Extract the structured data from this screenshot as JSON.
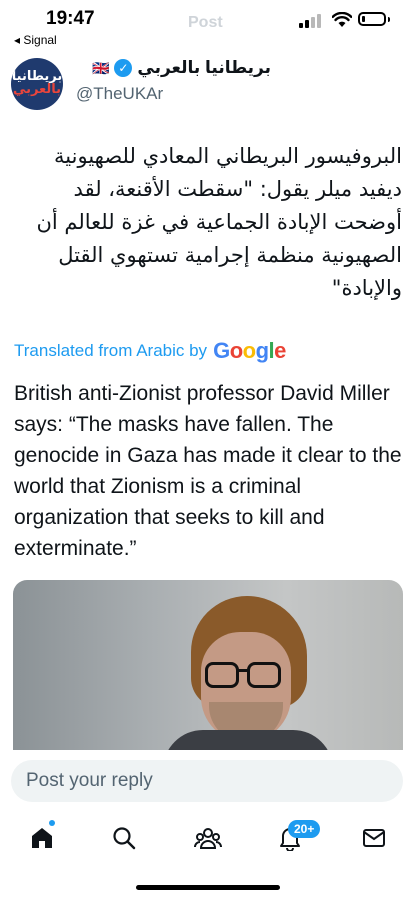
{
  "status_bar": {
    "time": "19:47",
    "back_app": "◂ Signal",
    "faded_title": "Post",
    "signal_bars": 2,
    "battery_level": 0.15
  },
  "post": {
    "author_name": "بريطانيا بالعربي",
    "author_flag": "🇬🇧",
    "handle": "@TheUKAr",
    "avatar_text_line1": "بريطانيا",
    "avatar_text_line2": "بالعربي",
    "arabic_text": "البروفيسور البريطاني المعادي للصهيونية ديفيد ميلر يقول: \"سقطت الأقنعة، لقد أوضحت الإبادة الجماعية في غزة للعالم أن الصهيونية منظمة إجرامية تستهوي القتل والإبادة\"",
    "translated_label": "Translated from Arabic by",
    "google_logo": {
      "G": "G",
      "o1": "o",
      "o2": "o",
      "g": "g",
      "l": "l",
      "e": "e"
    },
    "english_text": "British anti-Zionist professor David Miller says: “The masks have fallen. The genocide in Gaza has made it clear to the world that Zionism is a criminal organization that seeks to kill and exterminate.”"
  },
  "reply": {
    "placeholder": "Post your reply"
  },
  "tabbar": {
    "items": [
      {
        "icon": "home-icon"
      },
      {
        "icon": "search-icon"
      },
      {
        "icon": "communities-icon"
      },
      {
        "icon": "notifications-icon"
      },
      {
        "icon": "messages-icon"
      }
    ],
    "notification_badge": "20+"
  },
  "colors": {
    "accent": "#1d9bf0",
    "text": "#0f1419",
    "secondary": "#536471"
  }
}
